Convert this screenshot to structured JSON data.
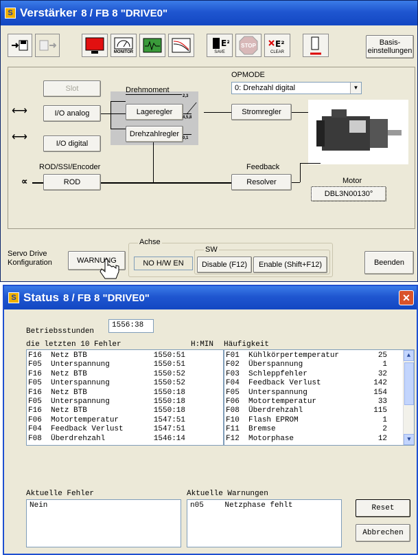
{
  "amp": {
    "title": "Verstärker",
    "subtitle": "8 / FB 8 \"DRIVE0\"",
    "toolbar": {
      "monitor": "MONITOR",
      "save": "SAVE",
      "stop": "STOP",
      "clear": "CLEAR",
      "basis": "Basis-\neinstellungen"
    },
    "slot": "Slot",
    "io_analog": "I/O analog",
    "io_digital": "I/O digital",
    "drehmoment": "Drehmoment",
    "lageregler": "Lageregler",
    "drehzahlregler": "Drehzahlregler",
    "stromregler": "Stromregler",
    "sw_23": "2,3",
    "sw_458": "4,5,8",
    "sw_01": "0,1",
    "opmode_label": "OPMODE",
    "opmode_value": "0: Drehzahl digital",
    "rod_label": "ROD/SSI/Encoder",
    "rod_btn": "ROD",
    "feedback_label": "Feedback",
    "resolver_btn": "Resolver",
    "motor_label": "Motor",
    "motor_value": "DBL3N00130°",
    "servo_drive": "Servo Drive\nKonfiguration",
    "warnung_btn": "WARNUNG",
    "achse_label": "Achse",
    "achse_value": "NO H/W EN",
    "sw_label": "SW",
    "disable_btn": "Disable (F12)",
    "enable_btn": "Enable (Shift+F12)",
    "beenden_btn": "Beenden"
  },
  "status": {
    "title": "Status",
    "subtitle": "8 / FB 8 \"DRIVE0\"",
    "betriebsstunden_label": "Betriebsstunden",
    "betriebsstunden_value": "1556:38",
    "header_errors": "die letzten 10 Fehler",
    "header_hmin": "H:MIN",
    "header_freq": "Häufigkeit",
    "last_errors": [
      {
        "code": "F16",
        "text": "Netz BTB",
        "time": "1550:51"
      },
      {
        "code": "F05",
        "text": "Unterspannung",
        "time": "1550:51"
      },
      {
        "code": "F16",
        "text": "Netz BTB",
        "time": "1550:52"
      },
      {
        "code": "F05",
        "text": "Unterspannung",
        "time": "1550:52"
      },
      {
        "code": "F16",
        "text": "Netz BTB",
        "time": "1550:18"
      },
      {
        "code": "F05",
        "text": "Unterspannung",
        "time": "1550:18"
      },
      {
        "code": "F16",
        "text": "Netz BTB",
        "time": "1550:18"
      },
      {
        "code": "F06",
        "text": "Motortemperatur",
        "time": "1547:51"
      },
      {
        "code": "F04",
        "text": "Feedback Verlust",
        "time": "1547:51"
      },
      {
        "code": "F08",
        "text": "Überdrehzahl",
        "time": "1546:14"
      }
    ],
    "frequency": [
      {
        "code": "F01",
        "text": "Kühlkörpertemperatur",
        "count": "25"
      },
      {
        "code": "F02",
        "text": "Überspannung",
        "count": "1"
      },
      {
        "code": "F03",
        "text": "Schleppfehler",
        "count": "32"
      },
      {
        "code": "F04",
        "text": "Feedback Verlust",
        "count": "142"
      },
      {
        "code": "F05",
        "text": "Unterspannung",
        "count": "154"
      },
      {
        "code": "F06",
        "text": "Motortemperatur",
        "count": "33"
      },
      {
        "code": "F08",
        "text": "Überdrehzahl",
        "count": "115"
      },
      {
        "code": "F10",
        "text": "Flash EPROM",
        "count": "1"
      },
      {
        "code": "F11",
        "text": "Bremse",
        "count": "2"
      },
      {
        "code": "F12",
        "text": "Motorphase",
        "count": "12"
      }
    ],
    "current_errors_label": "Aktuelle Fehler",
    "current_errors_value": "Nein",
    "current_warnings_label": "Aktuelle Warnungen",
    "current_warning_code": "n05",
    "current_warning_text": "Netzphase fehlt",
    "reset_btn": "Reset",
    "abbrechen_btn": "Abbrechen"
  }
}
